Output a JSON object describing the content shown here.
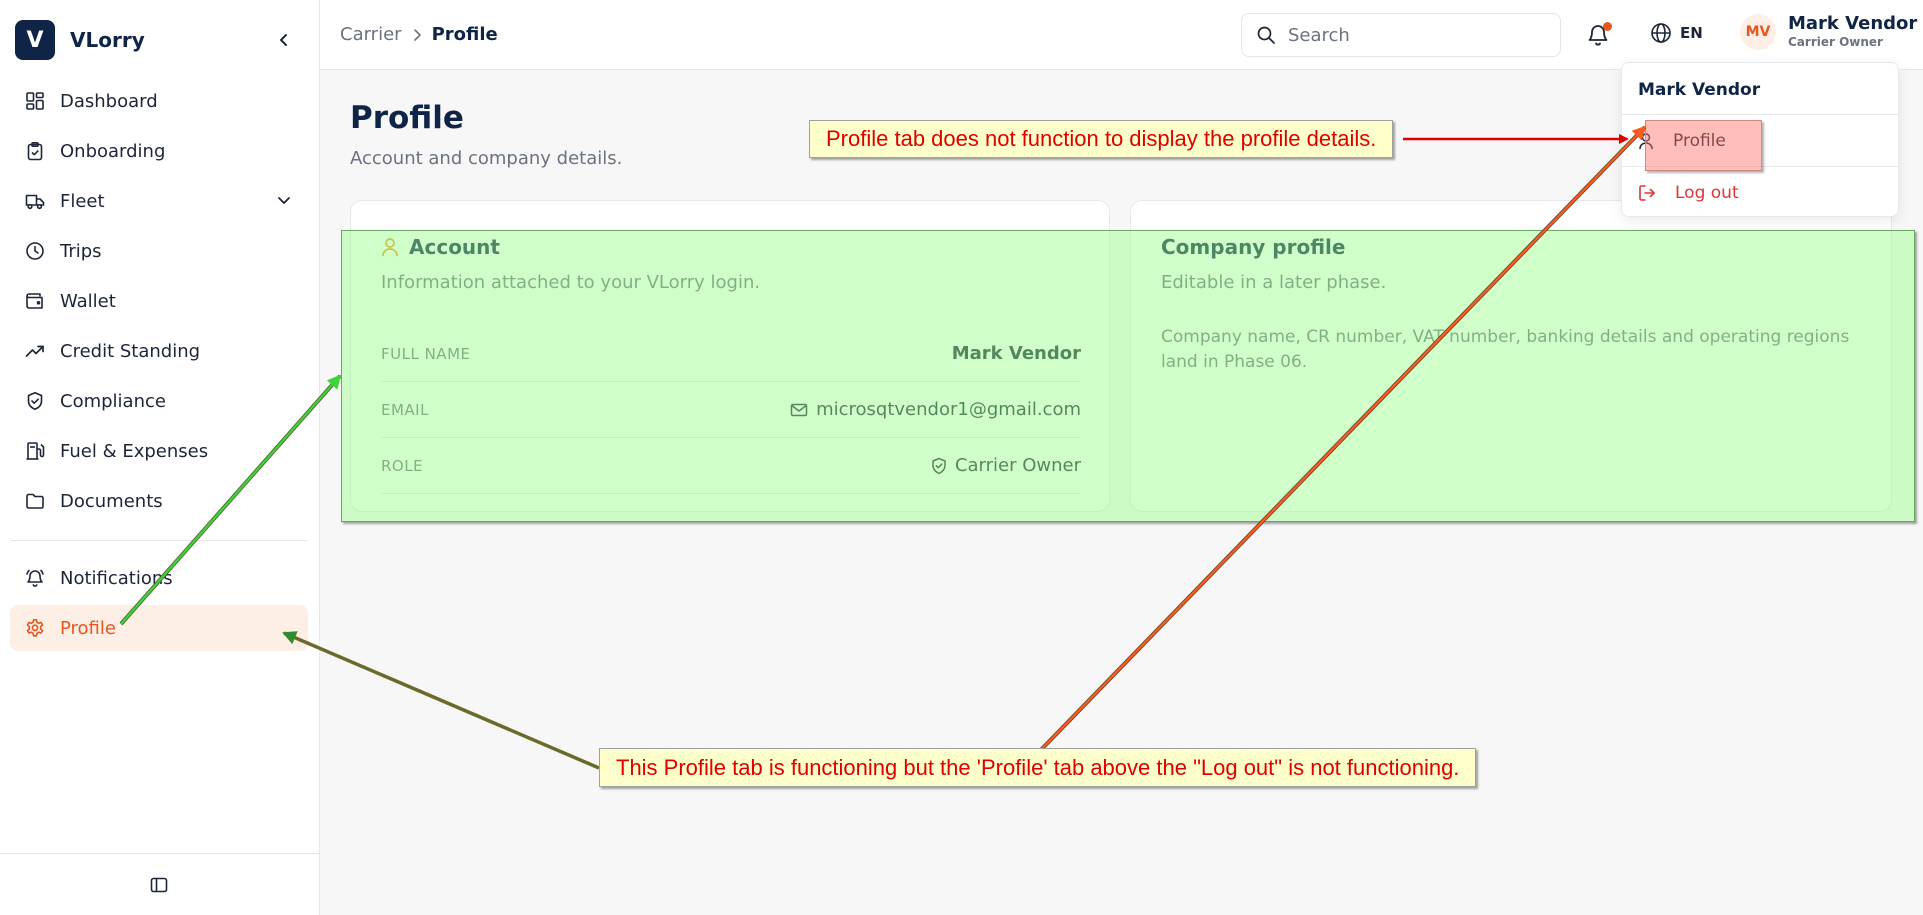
{
  "brand": {
    "logo_letter": "V",
    "name": "VLorry"
  },
  "sidebar": {
    "items": [
      {
        "label": "Dashboard",
        "icon": "dashboard-icon"
      },
      {
        "label": "Onboarding",
        "icon": "clipboard-icon"
      },
      {
        "label": "Fleet",
        "icon": "truck-icon",
        "expandable": true
      },
      {
        "label": "Trips",
        "icon": "clock-icon"
      },
      {
        "label": "Wallet",
        "icon": "wallet-icon"
      },
      {
        "label": "Credit Standing",
        "icon": "trending-up-icon"
      },
      {
        "label": "Compliance",
        "icon": "shield-check-icon"
      },
      {
        "label": "Fuel & Expenses",
        "icon": "fuel-icon"
      },
      {
        "label": "Documents",
        "icon": "folder-icon"
      }
    ],
    "bottom_items": [
      {
        "label": "Notifications",
        "icon": "bell-icon"
      },
      {
        "label": "Profile",
        "icon": "gear-icon",
        "active": true
      }
    ],
    "active_color": "#e8561b"
  },
  "header": {
    "breadcrumb": {
      "parent": "Carrier",
      "current": "Profile"
    },
    "search": {
      "placeholder": "Search",
      "value": ""
    },
    "language": "EN",
    "user": {
      "initials": "MV",
      "name": "Mark Vendor",
      "role": "Carrier Owner"
    }
  },
  "main": {
    "title": "Profile",
    "subtitle": "Account and company details.",
    "account_card": {
      "title": "Account",
      "subtitle": "Information attached to your VLorry login.",
      "rows": [
        {
          "label": "FULL NAME",
          "value": "Mark Vendor"
        },
        {
          "label": "EMAIL",
          "value": "microsqtvendor1@gmail.com",
          "icon": "mail-icon"
        },
        {
          "label": "ROLE",
          "value": "Carrier Owner",
          "icon": "shield-check-icon"
        }
      ]
    },
    "company_card": {
      "title": "Company profile",
      "subtitle": "Editable in a later phase.",
      "body": "Company name, CR number, VAT number, banking details and operating regions land in Phase 06."
    }
  },
  "user_menu": {
    "header": "Mark Vendor",
    "items": [
      {
        "label": "Profile",
        "icon": "user-icon"
      },
      {
        "label": "Log out",
        "icon": "logout-icon"
      }
    ]
  },
  "annotations": {
    "top_callout": "Profile tab does not function to display the profile details.",
    "bottom_callout": "This Profile tab is functioning but the 'Profile' tab above the \"Log out\" is not functioning."
  },
  "colors": {
    "brand_navy": "#0f2447",
    "accent_orange": "#e8561b",
    "logout_red": "#e03434",
    "annotation_text": "#e00000",
    "annotation_bg": "#ffffcc",
    "overlay_green": "#97ff8a",
    "overlay_red": "#ff6e64"
  }
}
